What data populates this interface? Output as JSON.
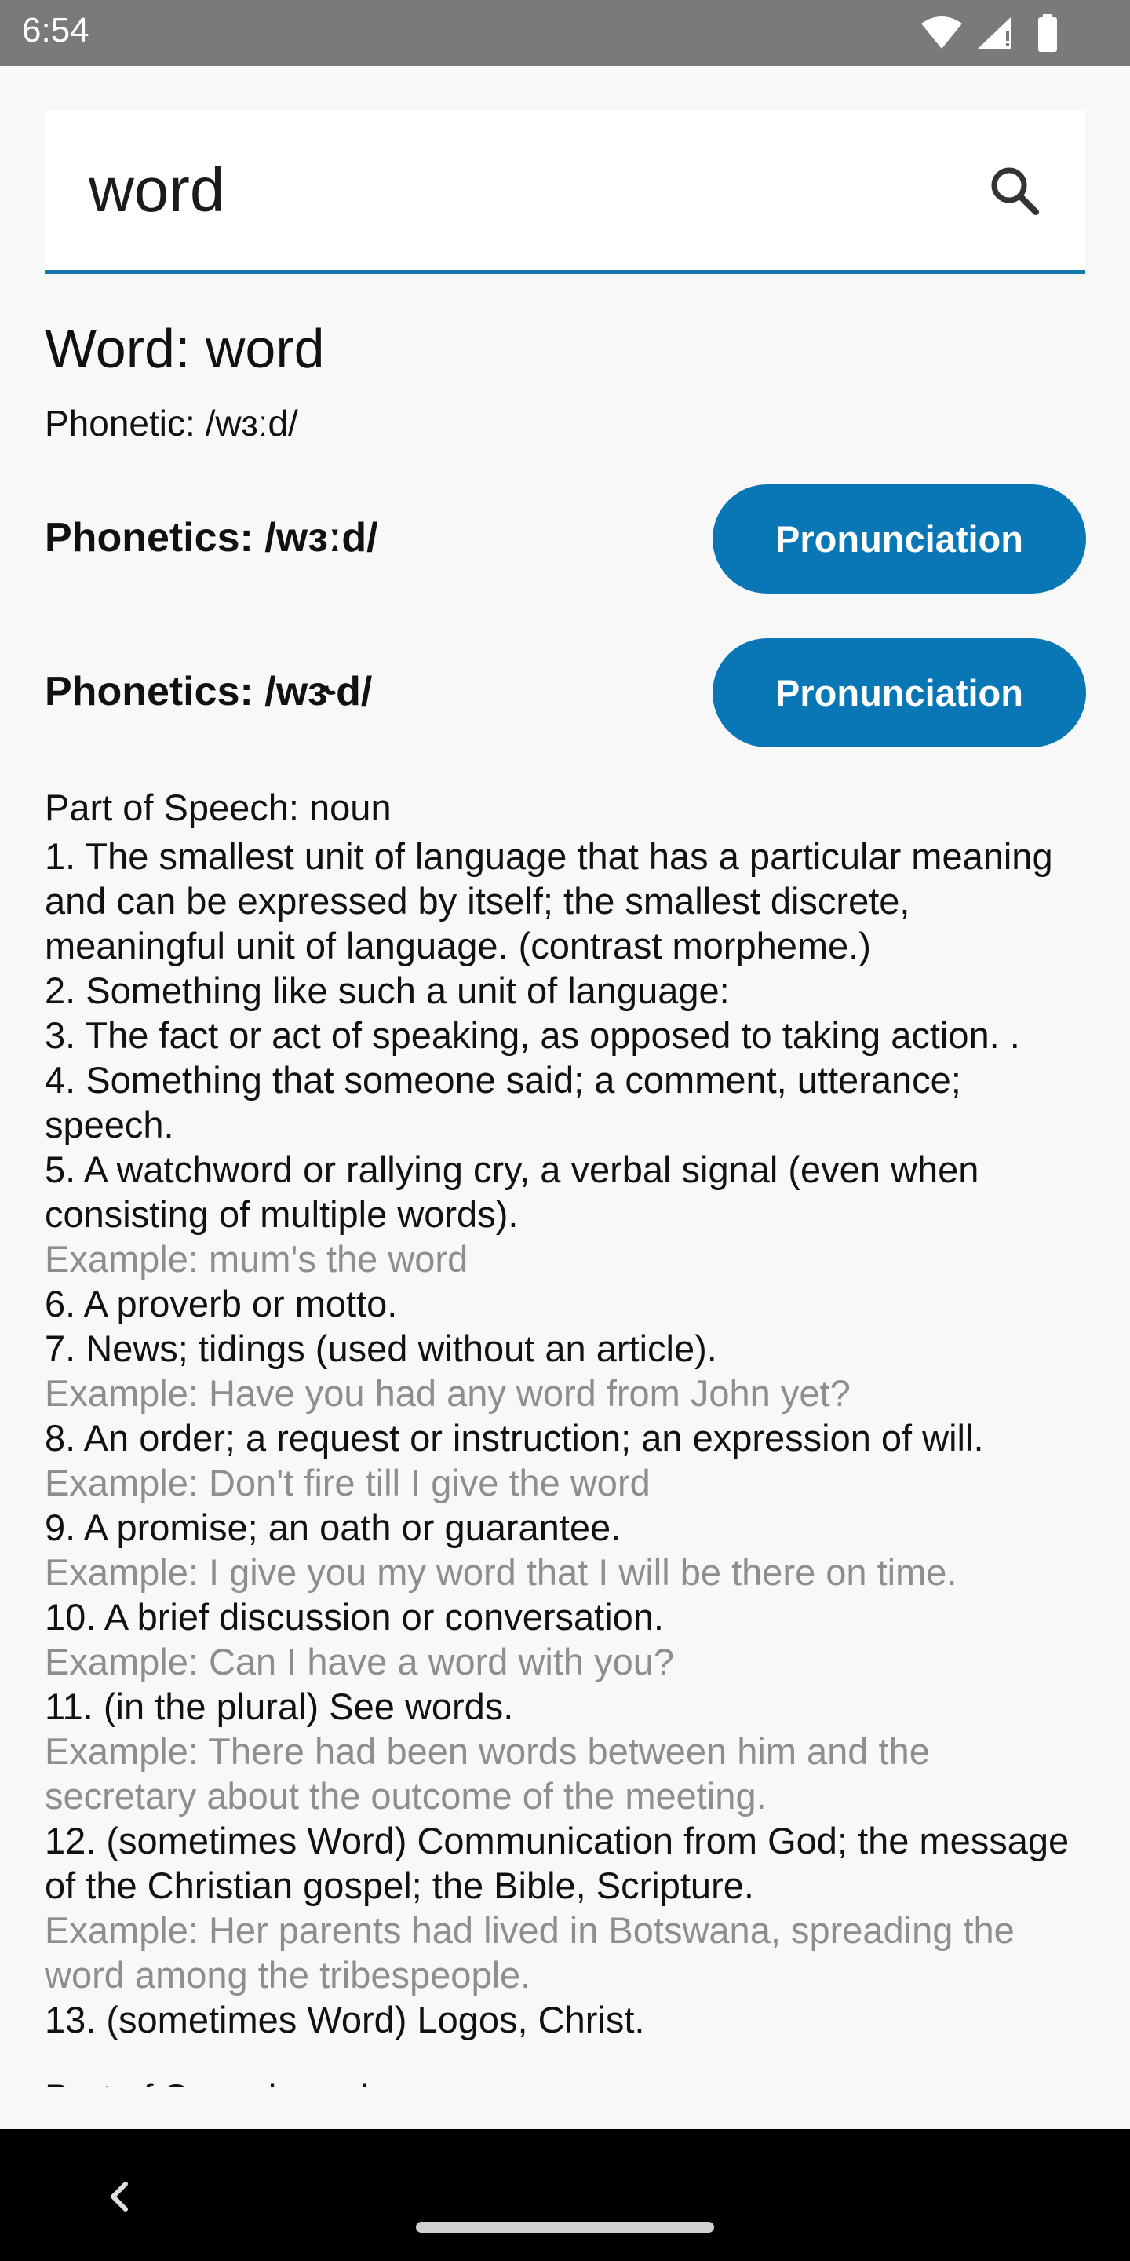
{
  "status_bar": {
    "time": "6:54"
  },
  "search": {
    "value": "word"
  },
  "word_header": {
    "title": "Word: word",
    "phonetic": "Phonetic: /wɜːd/"
  },
  "phonetics": [
    {
      "label": "Phonetics: /wɜːd/",
      "button": "Pronunciation"
    },
    {
      "label": "Phonetics: /wɝd/",
      "button": "Pronunciation"
    }
  ],
  "meanings": [
    {
      "part_of_speech": "Part of Speech: noun",
      "lines": [
        {
          "text": "1. The smallest unit of language that has a particular meaning and can be expressed by itself; the smallest discrete, meaningful unit of language. (contrast morpheme.)",
          "type": "definition"
        },
        {
          "text": "2. Something like such a unit of language:",
          "type": "definition"
        },
        {
          "text": "3. The fact or act of speaking, as opposed to taking action. .",
          "type": "definition"
        },
        {
          "text": "4. Something that someone said; a comment, utterance; speech.",
          "type": "definition"
        },
        {
          "text": "5. A watchword or rallying cry, a verbal signal (even when consisting of multiple words).",
          "type": "definition"
        },
        {
          "text": "Example: mum's the word",
          "type": "example"
        },
        {
          "text": "6. A proverb or motto.",
          "type": "definition"
        },
        {
          "text": "7. News; tidings (used without an article).",
          "type": "definition"
        },
        {
          "text": "Example: Have you had any word from John yet?",
          "type": "example"
        },
        {
          "text": "8. An order; a request or instruction; an expression of will.",
          "type": "definition"
        },
        {
          "text": "Example: Don't fire till I give the word",
          "type": "example"
        },
        {
          "text": "9. A promise; an oath or guarantee.",
          "type": "definition"
        },
        {
          "text": "Example: I give you my word that I will be there on time.",
          "type": "example"
        },
        {
          "text": "10. A brief discussion or conversation.",
          "type": "definition"
        },
        {
          "text": "Example: Can I have a word with you?",
          "type": "example"
        },
        {
          "text": "11. (in the plural) See words.",
          "type": "definition"
        },
        {
          "text": "Example: There had been words between him and the secretary about the outcome of the meeting.",
          "type": "example"
        },
        {
          "text": "12. (sometimes Word) Communication from God; the message of the Christian gospel; the Bible, Scripture.",
          "type": "definition"
        },
        {
          "text": "Example: Her parents had lived in Botswana, spreading the word among the tribespeople.",
          "type": "example"
        },
        {
          "text": "13. (sometimes Word) Logos, Christ.",
          "type": "definition"
        }
      ]
    },
    {
      "part_of_speech": "Part of Speech: verb",
      "lines": []
    }
  ],
  "colors": {
    "accent": "#0977b5",
    "underline": "#1477ac",
    "example_text": "#8e8e8e",
    "status_bar": "#7a7a7a",
    "background": "#f8f8f8"
  },
  "icons": {
    "status": [
      "wifi-icon",
      "signal-icon",
      "battery-icon"
    ],
    "search": "search-icon",
    "nav": [
      "back-icon",
      "home-handle"
    ]
  }
}
